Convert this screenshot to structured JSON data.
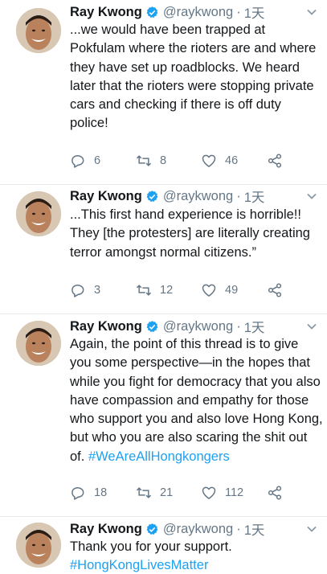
{
  "tweets": [
    {
      "name": "Ray Kwong",
      "handle": "@raykwong",
      "separator": "·",
      "time": "1天",
      "text": "...we would have been trapped at Pokfulam where the rioters are and where they have set up roadblocks. We heard later that the rioters were stopping private cars and checking if there is off duty police!",
      "hashtags": "",
      "replies": "6",
      "retweets": "8",
      "likes": "46"
    },
    {
      "name": "Ray Kwong",
      "handle": "@raykwong",
      "separator": "·",
      "time": "1天",
      "text": "...This first hand experience is horrible!! They [the protesters] are literally creating terror amongst normal citizens.”",
      "hashtags": "",
      "replies": "3",
      "retweets": "12",
      "likes": "49"
    },
    {
      "name": "Ray Kwong",
      "handle": "@raykwong",
      "separator": "·",
      "time": "1天",
      "text": "Again, the point of this thread is to give you some perspective—in the hopes that while you fight for democracy that you also have compassion and empathy for those who support you and also love Hong Kong, but who you are also scaring the shit out of. ",
      "hashtags": "#WeAreAllHongkongers",
      "replies": "18",
      "retweets": "21",
      "likes": "112"
    },
    {
      "name": "Ray Kwong",
      "handle": "@raykwong",
      "separator": "·",
      "time": "1天",
      "text": "Thank you for your support.\n",
      "hashtags": "#HongKongLivesMatter",
      "replies": "",
      "retweets": "",
      "likes": ""
    }
  ],
  "icons": {
    "verified": "verified-badge-icon",
    "more": "chevron-down-icon",
    "reply": "reply-icon",
    "retweet": "retweet-icon",
    "like": "heart-icon",
    "share": "share-icon"
  },
  "colors": {
    "accent": "#1da1f2",
    "secondary_text": "#657786",
    "separator": "#e6ecf0"
  }
}
